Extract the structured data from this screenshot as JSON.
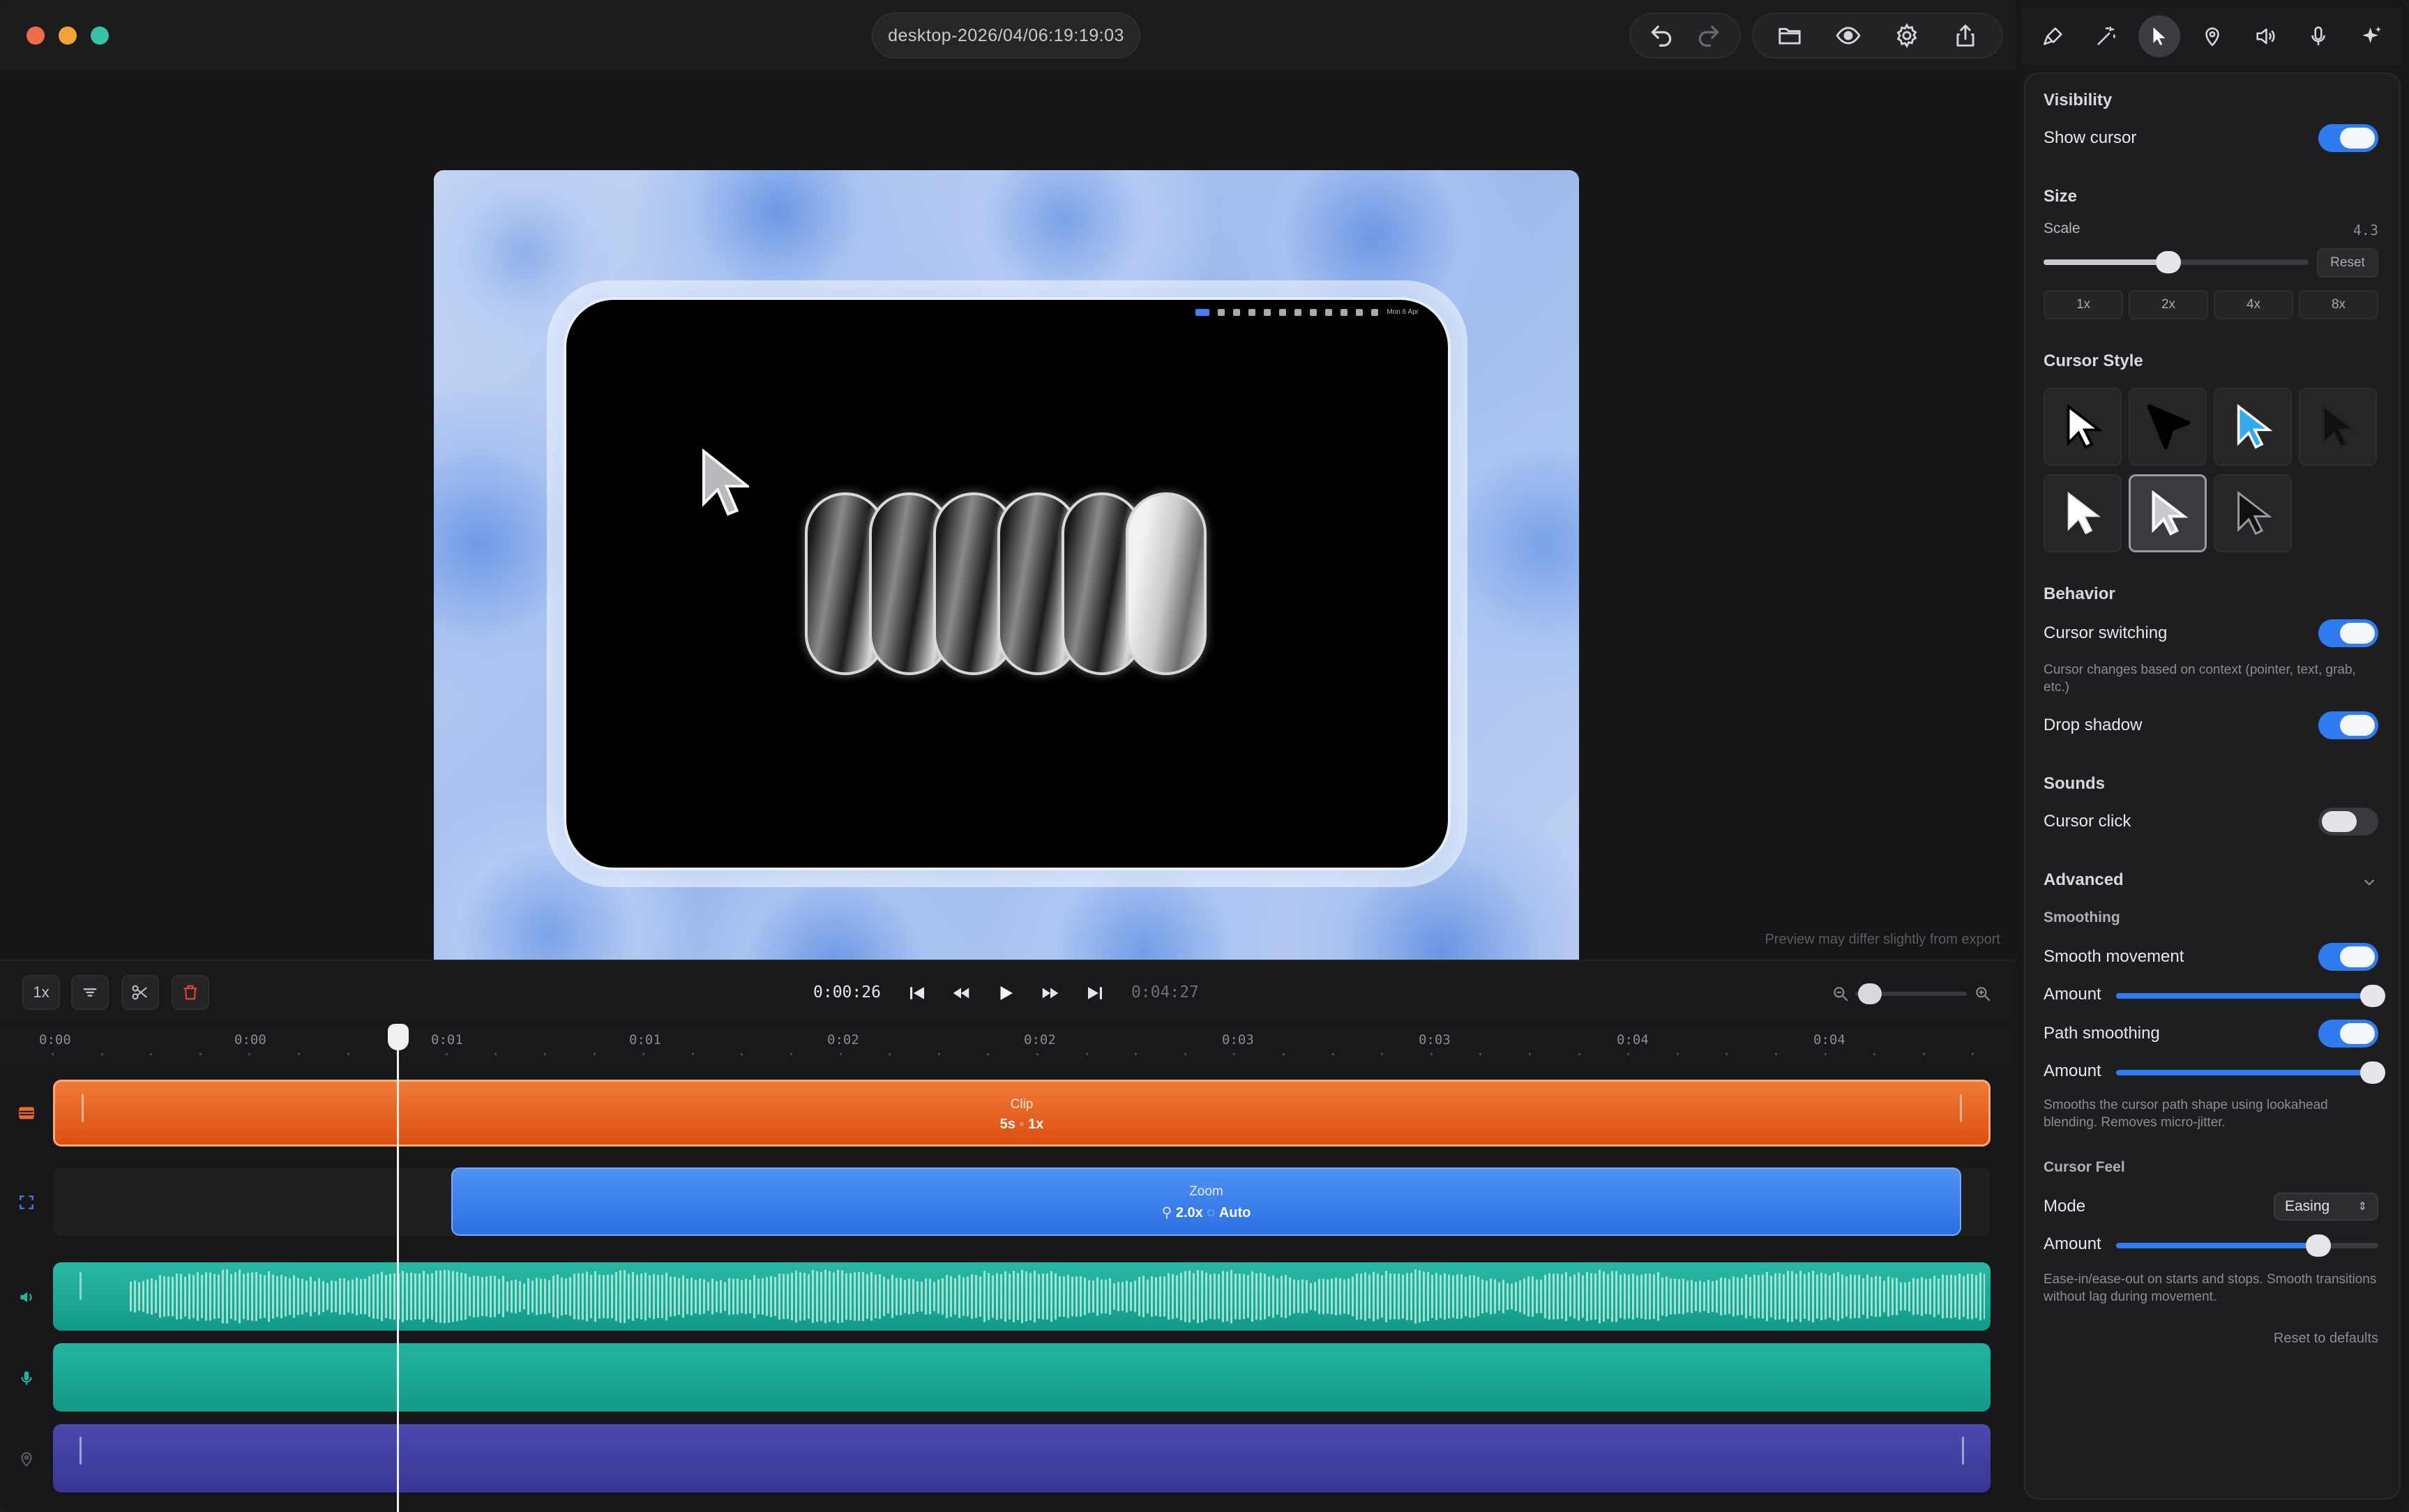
{
  "window": {
    "title": "desktop-2026/04/06:19:19:03",
    "traffic_colors": [
      "#f06b4c",
      "#f3a334",
      "#37c2a7"
    ]
  },
  "toolbar": {
    "icons": [
      "undo-icon",
      "redo-icon",
      "folder-icon",
      "eye-icon",
      "gear-icon",
      "share-icon"
    ]
  },
  "preview": {
    "note": "Preview may differ slightly from export",
    "mini_menubar_date": "Mon 6 Apr"
  },
  "timeline_toolbar": {
    "speed_label": "1x",
    "current_time": "0:00:26",
    "total_time": "0:04:27",
    "zoom_level": 0.02
  },
  "ruler": {
    "labels": [
      "0:00",
      "0:00",
      "0:01",
      "0:01",
      "0:02",
      "0:02",
      "0:03",
      "0:03",
      "0:04",
      "0:04"
    ]
  },
  "tracks": {
    "clip": {
      "title": "Clip",
      "duration": "5s",
      "speed": "1x"
    },
    "zoom": {
      "title": "Zoom",
      "level": "2.0x",
      "mode": "Auto"
    },
    "colors": {
      "clip": "#e2591a",
      "zoom": "#3a7ff0",
      "audio": "#1fab97",
      "mic": "#1ba892",
      "extra": "#413fa2"
    }
  },
  "panel": {
    "tabs": [
      "brush-icon",
      "magic-wand-icon",
      "cursor-icon",
      "location-pin-icon",
      "speaker-icon",
      "microphone-icon",
      "sparkle-icon"
    ],
    "active_tab": 2,
    "visibility": {
      "title": "Visibility",
      "show_cursor_label": "Show cursor",
      "show_cursor": true
    },
    "size": {
      "title": "Size",
      "scale_label": "Scale",
      "scale_value": "4.3",
      "scale_fraction": 0.47,
      "reset_label": "Reset",
      "presets": [
        "1x",
        "2x",
        "4x",
        "8x"
      ]
    },
    "cursor_style": {
      "title": "Cursor Style",
      "selected_index": 5
    },
    "behavior": {
      "title": "Behavior",
      "switching_label": "Cursor switching",
      "switching": true,
      "switching_hint": "Cursor changes based on context (pointer, text, grab, etc.)",
      "shadow_label": "Drop shadow",
      "shadow": true
    },
    "sounds": {
      "title": "Sounds",
      "click_label": "Cursor click",
      "click": false
    },
    "advanced": {
      "title": "Advanced",
      "smoothing_title": "Smoothing",
      "smooth_label": "Smooth movement",
      "smooth": true,
      "amount_label": "Amount",
      "smooth_amount": 0.98,
      "path_label": "Path smoothing",
      "path": true,
      "path_amount": 0.98,
      "path_hint": "Smooths the cursor path shape using lookahead blending. Removes micro-jitter.",
      "feel_title": "Cursor Feel",
      "mode_label": "Mode",
      "mode_value": "Easing",
      "feel_amount": 0.77,
      "feel_hint": "Ease-in/ease-out on starts and stops. Smooth transitions without lag during movement.",
      "reset_defaults": "Reset to defaults"
    }
  }
}
